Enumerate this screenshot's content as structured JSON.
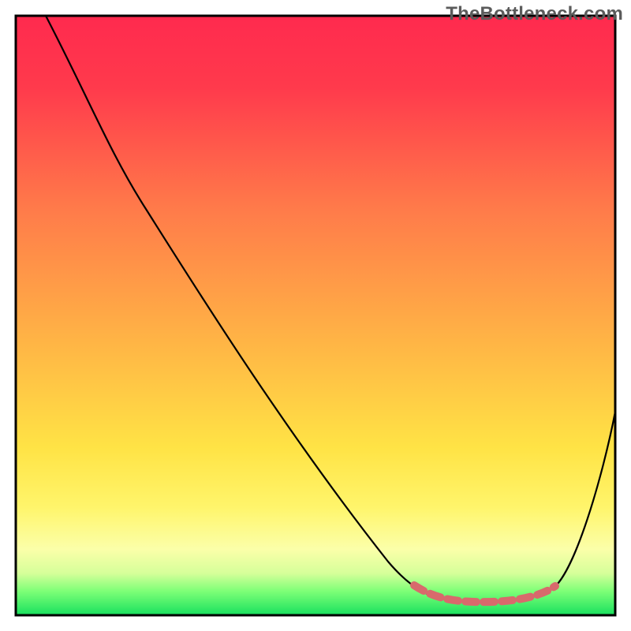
{
  "watermark": "TheBottleneck.com",
  "chart_data": {
    "type": "line",
    "title": "",
    "xlabel": "",
    "ylabel": "",
    "xlim": [
      0,
      100
    ],
    "ylim": [
      0,
      100
    ],
    "background_gradient": {
      "direction": "vertical",
      "stops": [
        {
          "pos": 0.0,
          "color": "#ff2a4e",
          "meaning": "high bottleneck"
        },
        {
          "pos": 0.32,
          "color": "#ff7a4a"
        },
        {
          "pos": 0.55,
          "color": "#ffb645"
        },
        {
          "pos": 0.72,
          "color": "#ffe345"
        },
        {
          "pos": 0.89,
          "color": "#fbffa9"
        },
        {
          "pos": 1.0,
          "color": "#18e05e",
          "meaning": "no bottleneck"
        }
      ]
    },
    "series": [
      {
        "name": "bottleneck-curve",
        "color": "#000000",
        "x": [
          5,
          12,
          22,
          34,
          48,
          62,
          70,
          76,
          82,
          88,
          92,
          100
        ],
        "y": [
          100,
          86,
          68,
          50,
          26,
          7,
          2,
          0,
          0,
          2,
          10,
          32
        ]
      }
    ],
    "annotations": [
      {
        "name": "optimal-range",
        "style": "dashed-thick",
        "color": "#d86a6c",
        "x_range": [
          66,
          90
        ],
        "y_approx": 1
      }
    ]
  }
}
